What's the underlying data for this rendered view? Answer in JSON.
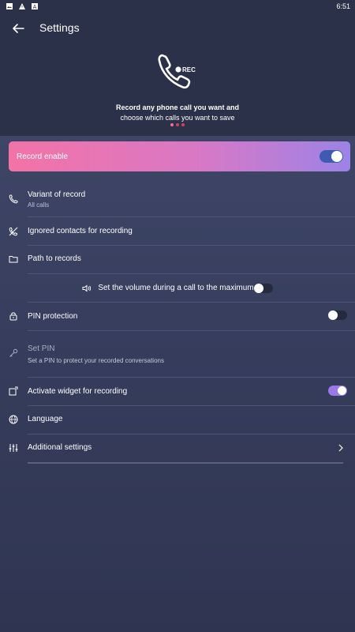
{
  "status_bar": {
    "time": "6:51",
    "icons": [
      "image-icon",
      "warning-icon",
      "a-icon"
    ]
  },
  "header": {
    "title": "Settings",
    "hero_icon": "phone-rec-icon",
    "hero_rec_label": "REC",
    "hero_line1": "Record any phone call you want and",
    "hero_line2": "choose which calls you want to save",
    "pager_dots": 3
  },
  "record_enable": {
    "label": "Record enable",
    "enabled": true
  },
  "settings": {
    "variant": {
      "label": "Variant of record",
      "value": "All calls",
      "icon": "phone-icon"
    },
    "ignored": {
      "label": "Ignored contacts for recording",
      "icon": "phone-off-icon"
    },
    "path": {
      "label": "Path to records",
      "icon": "folder-icon"
    },
    "volume": {
      "label": "Set the volume during a call to the maximum",
      "icon": "volume-icon",
      "enabled": false
    },
    "pin_protection": {
      "label": "PIN protection",
      "icon": "lock-icon",
      "enabled": false
    },
    "set_pin": {
      "label": "Set PIN",
      "description": "Set a PIN to protect your recorded conversations",
      "icon": "key-icon"
    },
    "widget": {
      "label": "Activate widget for recording",
      "icon": "widget-icon",
      "enabled": true
    },
    "language": {
      "label": "Language",
      "icon": "globe-icon"
    },
    "additional": {
      "label": "Additional settings",
      "icon": "sliders-icon"
    }
  },
  "colors": {
    "header_bg": "#2b3149",
    "content_bg": "#3e4566",
    "accent_pink": "#f373a6",
    "accent_purple": "#9c83e6",
    "switch_blue": "#3f5ab0",
    "switch_purple": "#9b78e8"
  }
}
